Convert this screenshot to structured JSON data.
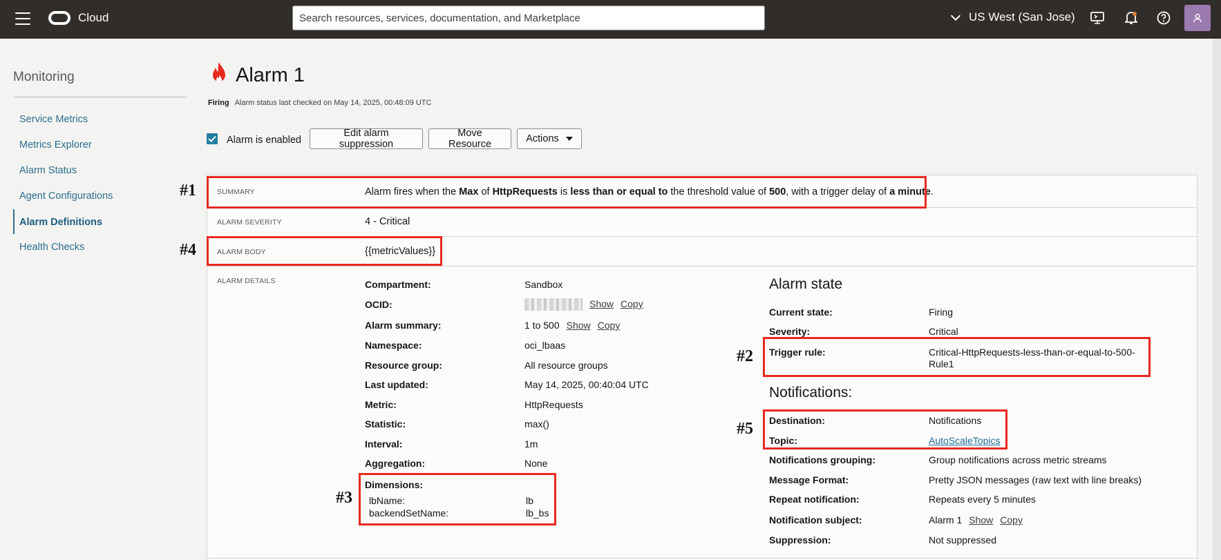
{
  "topbar": {
    "brand": "Cloud",
    "search_placeholder": "Search resources, services, documentation, and Marketplace",
    "region": "US West (San Jose)"
  },
  "sidebar": {
    "title": "Monitoring",
    "items": [
      {
        "label": "Service Metrics"
      },
      {
        "label": "Metrics Explorer"
      },
      {
        "label": "Alarm Status"
      },
      {
        "label": "Agent Configurations"
      },
      {
        "label": "Alarm Definitions"
      },
      {
        "label": "Health Checks"
      }
    ]
  },
  "header": {
    "title": "Alarm 1",
    "status": "Firing",
    "status_text": "Alarm status last checked on May 14, 2025, 00:48:09 UTC"
  },
  "actions": {
    "enabled_label": "Alarm is enabled",
    "edit_suppression": "Edit alarm suppression",
    "move_resource": "Move Resource",
    "actions_menu": "Actions"
  },
  "summary": {
    "label": "SUMMARY",
    "p1": "Alarm fires when the ",
    "b1": "Max",
    "p2": " of ",
    "b2": "HttpRequests",
    "p3": " is ",
    "b3": "less than or equal to",
    "p4": " the threshold value of ",
    "b4": "500",
    "p5": ", with a trigger delay of ",
    "b5": "a minute",
    "p6": "."
  },
  "severity": {
    "label": "ALARM SEVERITY",
    "value": "4 - Critical"
  },
  "body": {
    "label": "ALARM BODY",
    "value": "{{metricValues}}"
  },
  "details": {
    "label": "ALARM DETAILS",
    "compartment": {
      "k": "Compartment:",
      "v": "Sandbox"
    },
    "ocid": {
      "k": "OCID:",
      "show": "Show",
      "copy": "Copy"
    },
    "alarm_summary": {
      "k": "Alarm summary:",
      "v": "1 to 500",
      "show": "Show",
      "copy": "Copy"
    },
    "namespace": {
      "k": "Namespace:",
      "v": "oci_lbaas"
    },
    "resource_group": {
      "k": "Resource group:",
      "v": "All resource groups"
    },
    "last_updated": {
      "k": "Last updated:",
      "v": "May 14, 2025, 00:40:04 UTC"
    },
    "metric": {
      "k": "Metric:",
      "v": "HttpRequests"
    },
    "statistic": {
      "k": "Statistic:",
      "v": "max()"
    },
    "interval": {
      "k": "Interval:",
      "v": "1m"
    },
    "aggregation": {
      "k": "Aggregation:",
      "v": "None"
    },
    "dimensions": {
      "k": "Dimensions:",
      "lb_name_k": "lbName:",
      "lb_name_v": "lb",
      "backend_k": "backendSetName:",
      "backend_v": "lb_bs"
    }
  },
  "alarm_state": {
    "title": "Alarm state",
    "current_state": {
      "k": "Current state:",
      "v": "Firing"
    },
    "severity": {
      "k": "Severity:",
      "v": "Critical"
    },
    "trigger_rule": {
      "k": "Trigger rule:",
      "v1": "Critical-HttpRequests-less-than-or-equal-to-500-",
      "v2": "Rule1"
    }
  },
  "notifications": {
    "title": "Notifications:",
    "destination": {
      "k": "Destination:",
      "v": "Notifications"
    },
    "topic": {
      "k": "Topic:",
      "v": "AutoScaleTopics"
    },
    "grouping": {
      "k": "Notifications grouping:",
      "v": "Group notifications across metric streams"
    },
    "format": {
      "k": "Message Format:",
      "v": "Pretty JSON messages (raw text with line breaks)"
    },
    "repeat": {
      "k": "Repeat notification:",
      "v": "Repeats every 5 minutes"
    },
    "subject": {
      "k": "Notification subject:",
      "v": "Alarm 1",
      "show": "Show",
      "copy": "Copy"
    },
    "suppression": {
      "k": "Suppression:",
      "v": "Not suppressed"
    }
  },
  "annotations": {
    "a1": "#1",
    "a2": "#2",
    "a3": "#3",
    "a4": "#4",
    "a5": "#5"
  },
  "colors": {
    "annotation": "#e8291e",
    "topbar": "#312d2a",
    "link": "#2b6f8f",
    "checkbox": "#227e9e"
  }
}
